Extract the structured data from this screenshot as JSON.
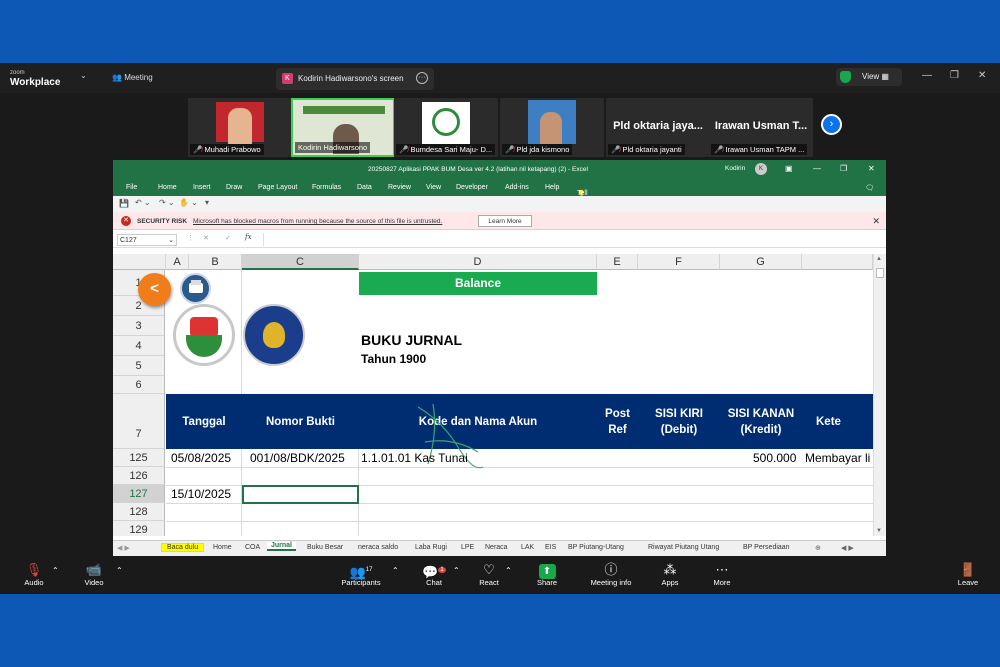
{
  "zoom": {
    "logo_small": "zoom",
    "logo_big": "Workplace",
    "meeting_label": "Meeting",
    "share_tab": "Kodirin Hadiwarsono's screen",
    "share_tab_initial": "K",
    "view_label": "View",
    "participants": [
      {
        "name": "Muhadi Prabowo"
      },
      {
        "name": "Kodirin Hadiwarsono"
      },
      {
        "name": "Bumdesa Sari Maju- D..."
      },
      {
        "name": "Pld jda kismono"
      },
      {
        "name": "Pld oktaria jayanti",
        "display": "Pld oktaria jaya..."
      },
      {
        "name": "Irawan Usman TAPM ...",
        "display": "Irawan Usman T..."
      }
    ],
    "toolbar": {
      "audio": "Audio",
      "video": "Video",
      "participants": "Participants",
      "participants_count": "17",
      "chat": "Chat",
      "chat_badge": "1",
      "react": "React",
      "share": "Share",
      "meeting_info": "Meeting info",
      "apps": "Apps",
      "more": "More",
      "leave": "Leave"
    }
  },
  "excel": {
    "title": "20250827 Aplikasi PPAK BUM Desa ver 4.2 (latihan nil ketapang) (2)  -  Excel",
    "user": "Kodirin",
    "user_initial": "K",
    "menu": [
      "File",
      "Home",
      "Insert",
      "Draw",
      "Page Layout",
      "Formulas",
      "Data",
      "Review",
      "View",
      "Developer",
      "Add-ins",
      "Help",
      "Tell me what you want to do"
    ],
    "security_label": "SECURITY RISK",
    "security_msg": "Microsoft has blocked macros from running because the source of this file is untrusted.",
    "learn_more": "Learn More",
    "name_box": "C127",
    "columns": [
      "A",
      "B",
      "C",
      "D",
      "E",
      "F",
      "G"
    ],
    "rows": [
      "1",
      "2",
      "3",
      "4",
      "5",
      "6",
      "7",
      "125",
      "126",
      "127",
      "128",
      "129"
    ],
    "balance": "Balance",
    "back_button": "<",
    "heading": "BUKU JURNAL",
    "subheading": "Tahun 1900",
    "table_headers": {
      "tanggal": "Tanggal",
      "nomor_bukti": "Nomor Bukti",
      "kode": "Kode dan Nama Akun",
      "post_ref": "Post Ref",
      "sisi_kiri": "SISI KIRI (Debit)",
      "sisi_kanan": "SISI KANAN (Kredit)",
      "ket": "Kete"
    },
    "rows_data": [
      {
        "tanggal": "05/08/2025",
        "bukti": "001/08/BDK/2025",
        "akun": "1.1.01.01 Kas Tunai",
        "kredit": "500.000",
        "ket": "Membayar li"
      },
      {
        "tanggal": "15/10/2025"
      }
    ],
    "sheet_tabs": [
      "Baca dulu",
      "Home",
      "COA",
      "Jurnal",
      "Buku Besar",
      "neraca saldo",
      "Laba Rugi",
      "LPE",
      "Neraca",
      "LAK",
      "EIS",
      "BP Piutang-Utang",
      "Riwayat Piutang Utang",
      "BP Persediaan"
    ],
    "active_tab": "Jurnal"
  }
}
